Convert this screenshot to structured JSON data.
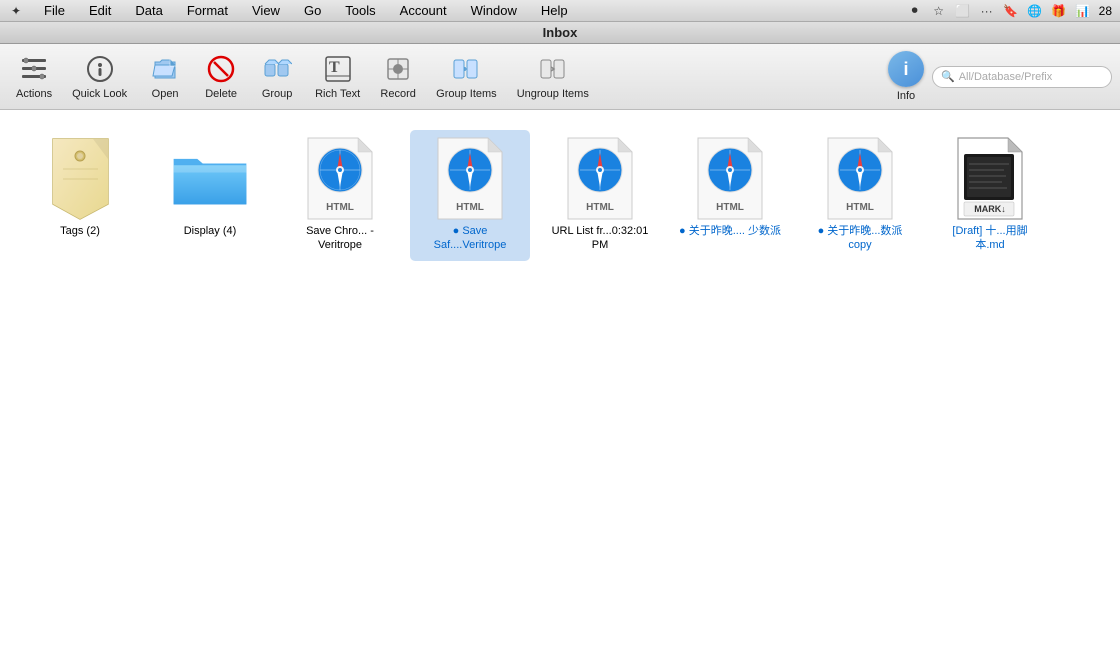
{
  "menubar": {
    "items": [
      "File",
      "Edit",
      "Data",
      "Format",
      "View",
      "Go",
      "Tools",
      "Account",
      "Window",
      "Help"
    ],
    "app_icon": "◆",
    "time": "28",
    "right_icons": [
      "record-icon",
      "star-icon",
      "box-icon",
      "dots-icon",
      "bookmark-icon",
      "globe-icon",
      "gift-icon",
      "bars-icon"
    ]
  },
  "titlebar": {
    "title": "Inbox"
  },
  "toolbar": {
    "actions_label": "Actions",
    "quick_look_label": "Quick Look",
    "open_label": "Open",
    "delete_label": "Delete",
    "group_label": "Group",
    "rich_text_label": "Rich Text",
    "record_label": "Record",
    "group_items_label": "Group Items",
    "ungroup_items_label": "Ungroup Items",
    "info_label": "Info",
    "search_placeholder": "All/Database/Prefix"
  },
  "files": [
    {
      "id": "tags",
      "type": "tag",
      "label": "Tags (2)",
      "label_color": "normal"
    },
    {
      "id": "display",
      "type": "folder",
      "label": "Display (4)",
      "label_color": "normal"
    },
    {
      "id": "savechro",
      "type": "html",
      "label": "Save Chro... - Veritrope",
      "label_color": "normal"
    },
    {
      "id": "savesaf",
      "type": "html",
      "label": "Save Saf....Veritrope",
      "label_color": "tagged-blue",
      "tagged": true
    },
    {
      "id": "urllist",
      "type": "html",
      "label": "URL List fr...0:32:01 PM",
      "label_color": "normal"
    },
    {
      "id": "guanyuzuotian1",
      "type": "html",
      "label": "关于昨晚.... 少数派",
      "label_color": "tagged-blue",
      "tagged": true
    },
    {
      "id": "guanyuzuotian2",
      "type": "html",
      "label": "关于昨晚...数派 copy",
      "label_color": "tagged-blue",
      "tagged": true
    },
    {
      "id": "draftmd",
      "type": "markdown",
      "label": "[Draft] 十...用脚本.md",
      "label_color": "blue"
    }
  ]
}
